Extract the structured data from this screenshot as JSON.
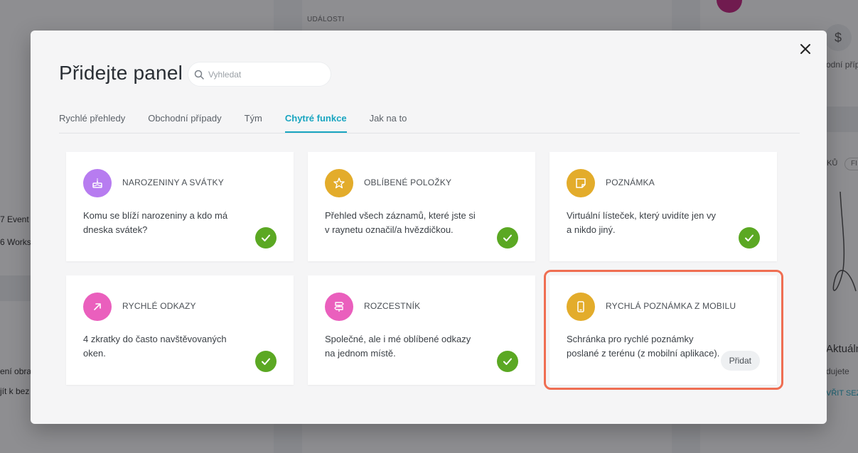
{
  "background": {
    "section_label": "UDÁLOSTI",
    "left_items": [
      "7 Event",
      "6 Works"
    ],
    "left_bottom": [
      "ení obra",
      "jít k bez"
    ],
    "right_top": "odní příp",
    "right_filter": "KŮ",
    "right_filter_chip": "FI",
    "right_heading": "Aktuáln",
    "right_text": "dujete",
    "right_link": "VŘIT SEZ"
  },
  "modal": {
    "title": "Přidejte panel",
    "search_placeholder": "Vyhledat",
    "tabs": [
      {
        "label": "Rychlé přehledy",
        "active": false
      },
      {
        "label": "Obchodní případy",
        "active": false
      },
      {
        "label": "Tým",
        "active": false
      },
      {
        "label": "Chytré funkce",
        "active": true
      },
      {
        "label": "Jak na to",
        "active": false
      }
    ],
    "cards": [
      {
        "title": "NAROZENINY A SVÁTKY",
        "desc": "Komu se blíží narozeniny a kdo má dneska svátek?",
        "icon": "cake-icon",
        "color": "#b77cf0",
        "added": true
      },
      {
        "title": "OBLÍBENÉ POLOŽKY",
        "desc": "Přehled všech záznamů, které jste si v raynetu označil/a hvězdičkou.",
        "icon": "star-icon",
        "color": "#e3ac2b",
        "added": true
      },
      {
        "title": "POZNÁMKA",
        "desc": "Virtuální lísteček, který uvidíte jen vy a nikdo jiný.",
        "icon": "note-icon",
        "color": "#e3ac2b",
        "added": true
      },
      {
        "title": "RYCHLÉ ODKAZY",
        "desc": "4 zkratky do často navštěvovaných oken.",
        "icon": "arrow-up-right-icon",
        "color": "#ea5fbd",
        "added": true
      },
      {
        "title": "ROZCESTNÍK",
        "desc": "Společné, ale i mé oblíbené odkazy na jednom místě.",
        "icon": "signpost-icon",
        "color": "#ea5fbd",
        "added": true
      },
      {
        "title": "RYCHLÁ POZNÁMKA Z MOBILU",
        "desc": "Schránka pro rychlé poznámky poslané z terénu (z mobilní aplikace).",
        "icon": "mobile-icon",
        "color": "#e3ac2b",
        "added": false,
        "add_label": "Přidat"
      }
    ]
  },
  "colors": {
    "accent": "#18a5c0",
    "check": "#5ba823",
    "highlight": "#ef6e52"
  }
}
